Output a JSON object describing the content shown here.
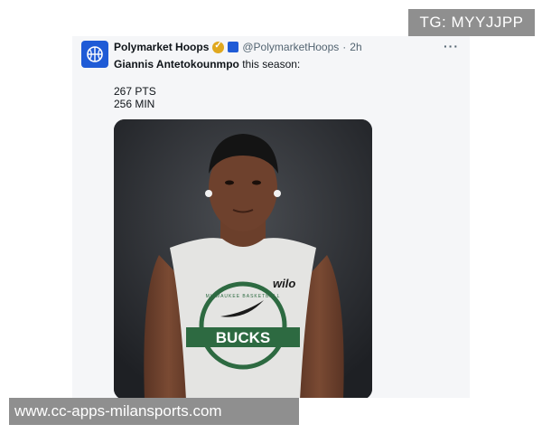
{
  "watermarks": {
    "top": "TG: MYYJJPP",
    "bottom": "www.cc-apps-milansports.com"
  },
  "tweet": {
    "display_name": "Polymarket Hoops",
    "handle": "@PolymarketHoops",
    "separator": "·",
    "time": "2h",
    "more_label": "···",
    "text_player": "Giannis Antetokounmpo",
    "text_rest": " this season:",
    "stats": [
      "267 PTS",
      "256 MIN"
    ],
    "photo": {
      "jersey_brand": "wilo",
      "jersey_team": "BUCKS",
      "jersey_arc_text": "MILWAUKEE BASKETBALL"
    }
  },
  "colors": {
    "accent": "#1f5bd6",
    "verified_gold": "#e0a81e",
    "jersey_green": "#2d6a41"
  }
}
